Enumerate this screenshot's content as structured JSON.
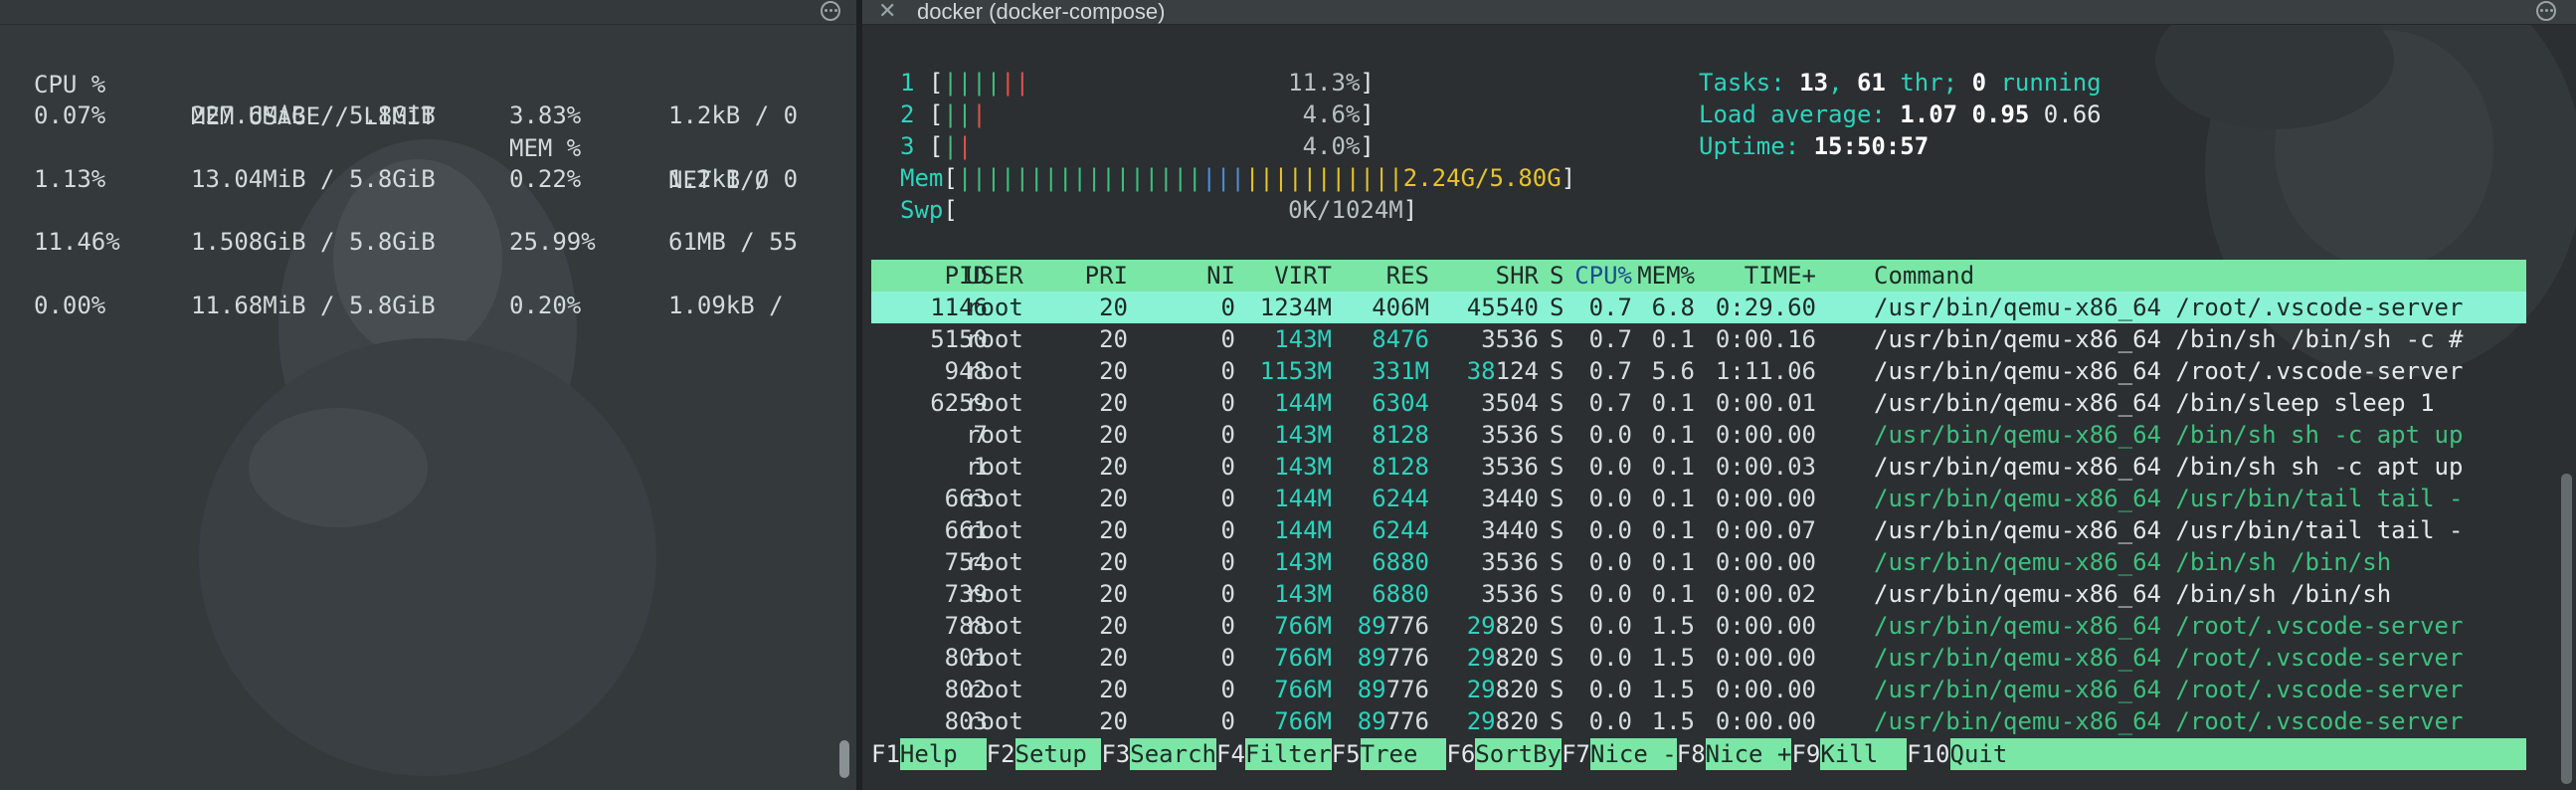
{
  "left_panel": {
    "headers": [
      "CPU %",
      "MEM USAGE / LIMIT",
      "MEM %",
      "NET I/O"
    ],
    "rows": [
      [
        "0.07%",
        "227.6MiB / 5.8GiB",
        "3.83%",
        "1.2kB / 0"
      ],
      [
        "1.13%",
        "13.04MiB / 5.8GiB",
        "0.22%",
        "1.2kB / 0"
      ],
      [
        "11.46%",
        "1.508GiB / 5.8GiB",
        "25.99%",
        "61MB / 55"
      ],
      [
        "0.00%",
        "11.68MiB / 5.8GiB",
        "0.20%",
        "1.09kB /"
      ]
    ]
  },
  "right_panel": {
    "title": "docker (docker-compose)",
    "cpus": [
      {
        "id": "1",
        "pct": "11.3%",
        "green": 4,
        "red": 2
      },
      {
        "id": "2",
        "pct": "4.6%",
        "green": 2,
        "red": 1
      },
      {
        "id": "3",
        "pct": "4.0%",
        "green": 1,
        "red": 1
      }
    ],
    "mem": {
      "label": "Mem",
      "value": "2.24G/5.80G"
    },
    "swp": {
      "label": "Swp",
      "value": "0K/1024M"
    },
    "tasks": {
      "label": "Tasks:",
      "count": "13",
      "sep": ",",
      "threads": "61",
      "thr_label": "thr;",
      "running": "0",
      "running_label": "running"
    },
    "load": {
      "label": "Load average:",
      "v1": "1.07",
      "v2": "0.95",
      "v3": "0.66"
    },
    "uptime": {
      "label": "Uptime:",
      "value": "15:50:57"
    },
    "columns": [
      "PID",
      "USER",
      "PRI",
      "NI",
      "VIRT",
      "RES",
      "SHR",
      "S",
      "CPU%",
      "MEM%",
      "TIME+",
      "Command"
    ],
    "processes": [
      {
        "pid": "1146",
        "user": "root",
        "pri": "20",
        "ni": "0",
        "virt": "1234M",
        "res": "406M",
        "shr": "45540",
        "s": "S",
        "cpu": "0.7",
        "mem": "6.8",
        "time": "0:29.60",
        "cmd": "/usr/bin/qemu-x86_64 /root/.vscode-server",
        "selected": true,
        "thread": false
      },
      {
        "pid": "5150",
        "user": "root",
        "pri": "20",
        "ni": "0",
        "virt": "143M",
        "res": "8476",
        "shr": "3536",
        "s": "S",
        "cpu": "0.7",
        "mem": "0.1",
        "time": "0:00.16",
        "cmd": "/usr/bin/qemu-x86_64 /bin/sh /bin/sh -c #",
        "selected": false,
        "thread": false
      },
      {
        "pid": "948",
        "user": "root",
        "pri": "20",
        "ni": "0",
        "virt": "1153M",
        "res": "331M",
        "shr": "38124",
        "s": "S",
        "cpu": "0.7",
        "mem": "5.6",
        "time": "1:11.06",
        "cmd": "/usr/bin/qemu-x86_64 /root/.vscode-server",
        "selected": false,
        "thread": false
      },
      {
        "pid": "6259",
        "user": "root",
        "pri": "20",
        "ni": "0",
        "virt": "144M",
        "res": "6304",
        "shr": "3504",
        "s": "S",
        "cpu": "0.7",
        "mem": "0.1",
        "time": "0:00.01",
        "cmd": "/usr/bin/qemu-x86_64 /bin/sleep sleep 1",
        "selected": false,
        "thread": false
      },
      {
        "pid": "7",
        "user": "root",
        "pri": "20",
        "ni": "0",
        "virt": "143M",
        "res": "8128",
        "shr": "3536",
        "s": "S",
        "cpu": "0.0",
        "mem": "0.1",
        "time": "0:00.00",
        "cmd": "/usr/bin/qemu-x86_64 /bin/sh sh -c apt up",
        "selected": false,
        "thread": true
      },
      {
        "pid": "1",
        "user": "root",
        "pri": "20",
        "ni": "0",
        "virt": "143M",
        "res": "8128",
        "shr": "3536",
        "s": "S",
        "cpu": "0.0",
        "mem": "0.1",
        "time": "0:00.03",
        "cmd": "/usr/bin/qemu-x86_64 /bin/sh sh -c apt up",
        "selected": false,
        "thread": false
      },
      {
        "pid": "663",
        "user": "root",
        "pri": "20",
        "ni": "0",
        "virt": "144M",
        "res": "6244",
        "shr": "3440",
        "s": "S",
        "cpu": "0.0",
        "mem": "0.1",
        "time": "0:00.00",
        "cmd": "/usr/bin/qemu-x86_64 /usr/bin/tail tail -",
        "selected": false,
        "thread": true
      },
      {
        "pid": "661",
        "user": "root",
        "pri": "20",
        "ni": "0",
        "virt": "144M",
        "res": "6244",
        "shr": "3440",
        "s": "S",
        "cpu": "0.0",
        "mem": "0.1",
        "time": "0:00.07",
        "cmd": "/usr/bin/qemu-x86_64 /usr/bin/tail tail -",
        "selected": false,
        "thread": false
      },
      {
        "pid": "754",
        "user": "root",
        "pri": "20",
        "ni": "0",
        "virt": "143M",
        "res": "6880",
        "shr": "3536",
        "s": "S",
        "cpu": "0.0",
        "mem": "0.1",
        "time": "0:00.00",
        "cmd": "/usr/bin/qemu-x86_64 /bin/sh /bin/sh",
        "selected": false,
        "thread": true
      },
      {
        "pid": "739",
        "user": "root",
        "pri": "20",
        "ni": "0",
        "virt": "143M",
        "res": "6880",
        "shr": "3536",
        "s": "S",
        "cpu": "0.0",
        "mem": "0.1",
        "time": "0:00.02",
        "cmd": "/usr/bin/qemu-x86_64 /bin/sh /bin/sh",
        "selected": false,
        "thread": false
      },
      {
        "pid": "788",
        "user": "root",
        "pri": "20",
        "ni": "0",
        "virt": "766M",
        "res": "89776",
        "shr": "29820",
        "s": "S",
        "cpu": "0.0",
        "mem": "1.5",
        "time": "0:00.00",
        "cmd": "/usr/bin/qemu-x86_64 /root/.vscode-server",
        "selected": false,
        "thread": true
      },
      {
        "pid": "801",
        "user": "root",
        "pri": "20",
        "ni": "0",
        "virt": "766M",
        "res": "89776",
        "shr": "29820",
        "s": "S",
        "cpu": "0.0",
        "mem": "1.5",
        "time": "0:00.00",
        "cmd": "/usr/bin/qemu-x86_64 /root/.vscode-server",
        "selected": false,
        "thread": true
      },
      {
        "pid": "802",
        "user": "root",
        "pri": "20",
        "ni": "0",
        "virt": "766M",
        "res": "89776",
        "shr": "29820",
        "s": "S",
        "cpu": "0.0",
        "mem": "1.5",
        "time": "0:00.00",
        "cmd": "/usr/bin/qemu-x86_64 /root/.vscode-server",
        "selected": false,
        "thread": true
      },
      {
        "pid": "803",
        "user": "root",
        "pri": "20",
        "ni": "0",
        "virt": "766M",
        "res": "89776",
        "shr": "29820",
        "s": "S",
        "cpu": "0.0",
        "mem": "1.5",
        "time": "0:00.00",
        "cmd": "/usr/bin/qemu-x86_64 /root/.vscode-server",
        "selected": false,
        "thread": true
      }
    ],
    "fkeys": [
      {
        "key": "F1",
        "label": "Help  "
      },
      {
        "key": "F2",
        "label": "Setup "
      },
      {
        "key": "F3",
        "label": "Search"
      },
      {
        "key": "F4",
        "label": "Filter"
      },
      {
        "key": "F5",
        "label": "Tree  "
      },
      {
        "key": "F6",
        "label": "SortBy"
      },
      {
        "key": "F7",
        "label": "Nice -"
      },
      {
        "key": "F8",
        "label": "Nice +"
      },
      {
        "key": "F9",
        "label": "Kill  "
      },
      {
        "key": "F10",
        "label": "Quit"
      }
    ]
  },
  "colors": {
    "header_bar": "#7ae7a7",
    "selected_row": "#8af3d6",
    "label_cyan": "#2bd4bd",
    "bar_green": "#3ec07f",
    "bar_red": "#e0524a",
    "bar_blue": "#4a8fd9",
    "bar_yellow": "#e6c42a"
  },
  "icons": [
    "more-options-icon",
    "close-tab-icon"
  ]
}
